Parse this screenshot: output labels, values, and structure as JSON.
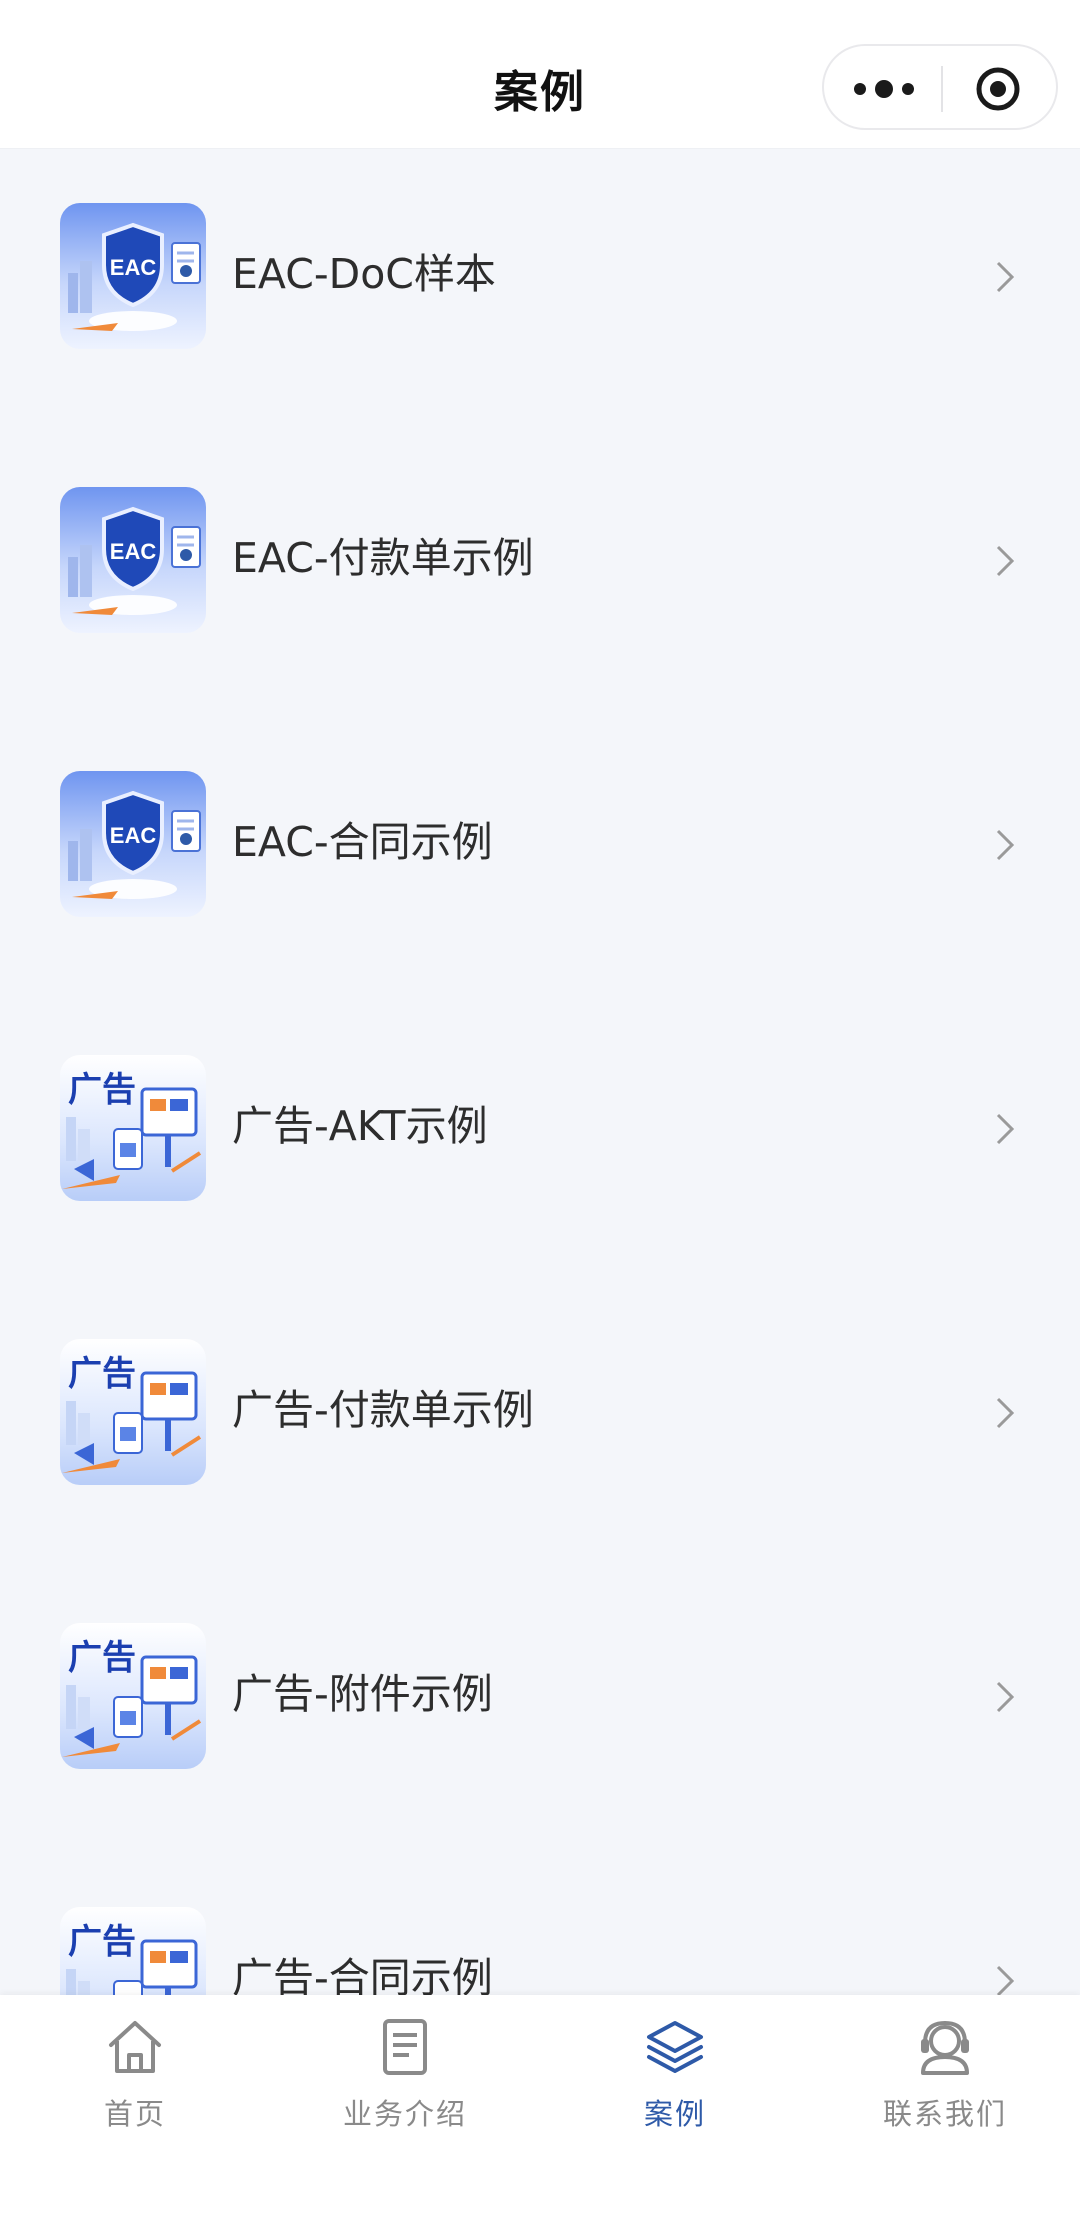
{
  "header": {
    "title": "案例",
    "more_icon": "more-dots-icon",
    "close_icon": "target-circle-icon"
  },
  "list": {
    "items": [
      {
        "label": "EAC-DoC样本",
        "thumb": "eac"
      },
      {
        "label": "EAC-付款单示例",
        "thumb": "eac"
      },
      {
        "label": "EAC-合同示例",
        "thumb": "eac"
      },
      {
        "label": "广告-AKT示例",
        "thumb": "ad",
        "thumb_text": "广告"
      },
      {
        "label": "广告-付款单示例",
        "thumb": "ad",
        "thumb_text": "广告"
      },
      {
        "label": "广告-附件示例",
        "thumb": "ad",
        "thumb_text": "广告"
      },
      {
        "label": "广告-合同示例",
        "thumb": "ad",
        "thumb_text": "广告"
      }
    ],
    "eac_badge_text": "EAC"
  },
  "tabbar": {
    "tabs": [
      {
        "label": "首页",
        "icon": "home-icon"
      },
      {
        "label": "业务介绍",
        "icon": "document-icon"
      },
      {
        "label": "案例",
        "icon": "layers-icon",
        "active": true
      },
      {
        "label": "联系我们",
        "icon": "headset-icon"
      }
    ]
  },
  "colors": {
    "accent": "#2e5aa8",
    "background": "#f4f6fa",
    "inactive": "#8a8a8a"
  }
}
